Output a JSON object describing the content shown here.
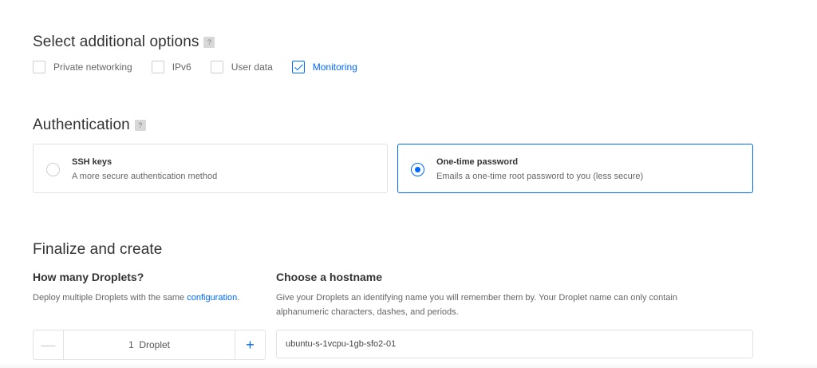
{
  "additional_options": {
    "title": "Select additional options",
    "help": "?",
    "items": [
      {
        "label": "Private networking",
        "checked": false
      },
      {
        "label": "IPv6",
        "checked": false
      },
      {
        "label": "User data",
        "checked": false
      },
      {
        "label": "Monitoring",
        "checked": true
      }
    ]
  },
  "authentication": {
    "title": "Authentication",
    "help": "?",
    "options": [
      {
        "title": "SSH keys",
        "description": "A more secure authentication method",
        "selected": false
      },
      {
        "title": "One-time password",
        "description": "Emails a one-time root password to you (less secure)",
        "selected": true
      }
    ]
  },
  "finalize": {
    "title": "Finalize and create",
    "droplets": {
      "title": "How many Droplets?",
      "description_prefix": "Deploy multiple Droplets with the same ",
      "description_link": "configuration",
      "description_suffix": ".",
      "minus": "—",
      "plus": "+",
      "value": "1  Droplet"
    },
    "hostname": {
      "title": "Choose a hostname",
      "description_line1": "Give your Droplets an identifying name you will remember them by. Your Droplet name can only contain",
      "description_line2": "alphanumeric characters, dashes, and periods.",
      "value": "ubuntu-s-1vcpu-1gb-sfo2-01"
    }
  },
  "colors": {
    "accent": "#0069ff",
    "text": "#333333",
    "muted": "#666666",
    "border": "#e2e2e2"
  }
}
